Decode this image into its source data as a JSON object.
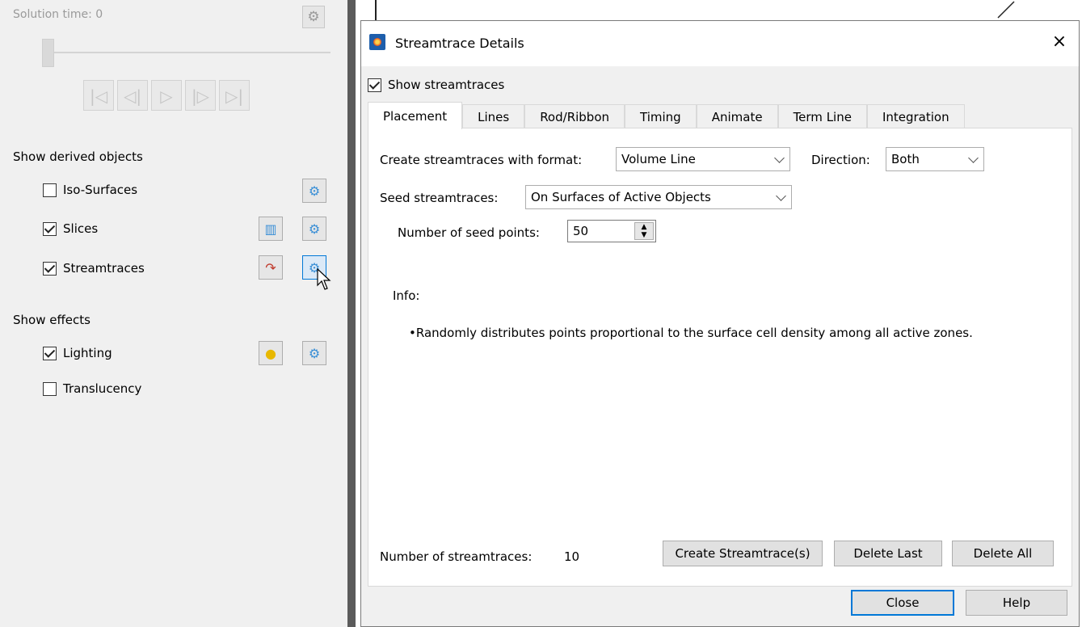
{
  "left_panel": {
    "solution_time": "Solution time: 0",
    "derived_heading": "Show derived objects",
    "effects_heading": "Show effects",
    "derived_items": [
      {
        "label": "Iso-Surfaces",
        "checked": false
      },
      {
        "label": "Slices",
        "checked": true
      },
      {
        "label": "Streamtraces",
        "checked": true
      }
    ],
    "effect_items": [
      {
        "label": "Lighting",
        "checked": true
      },
      {
        "label": "Translucency",
        "checked": false
      }
    ],
    "playback_icons": [
      "skip-to-start-icon",
      "step-back-icon",
      "play-icon",
      "step-forward-icon",
      "skip-to-end-icon"
    ]
  },
  "dialog": {
    "title": "Streamtrace Details",
    "close_symbol": "×",
    "show_streamtraces": {
      "label": "Show streamtraces",
      "checked": true
    },
    "tabs": [
      "Placement",
      "Lines",
      "Rod/Ribbon",
      "Timing",
      "Animate",
      "Term Line",
      "Integration"
    ],
    "active_tab": "Placement",
    "placement": {
      "format_label": "Create streamtraces with format:",
      "format_value": "Volume Line",
      "direction_label": "Direction:",
      "direction_value": "Both",
      "seed_label": "Seed streamtraces:",
      "seed_value": "On Surfaces of Active Objects",
      "seed_points_label": "Number of seed points:",
      "seed_points_value": "50",
      "info_title": "Info:",
      "info_text": "Randomly distributes points proportional to the surface cell density among all active zones.",
      "count_label": "Number of streamtraces:",
      "count_value": "10",
      "create_button": "Create Streamtrace(s)",
      "delete_last_button": "Delete Last",
      "delete_all_button": "Delete All"
    },
    "close_button": "Close",
    "help_button": "Help"
  }
}
